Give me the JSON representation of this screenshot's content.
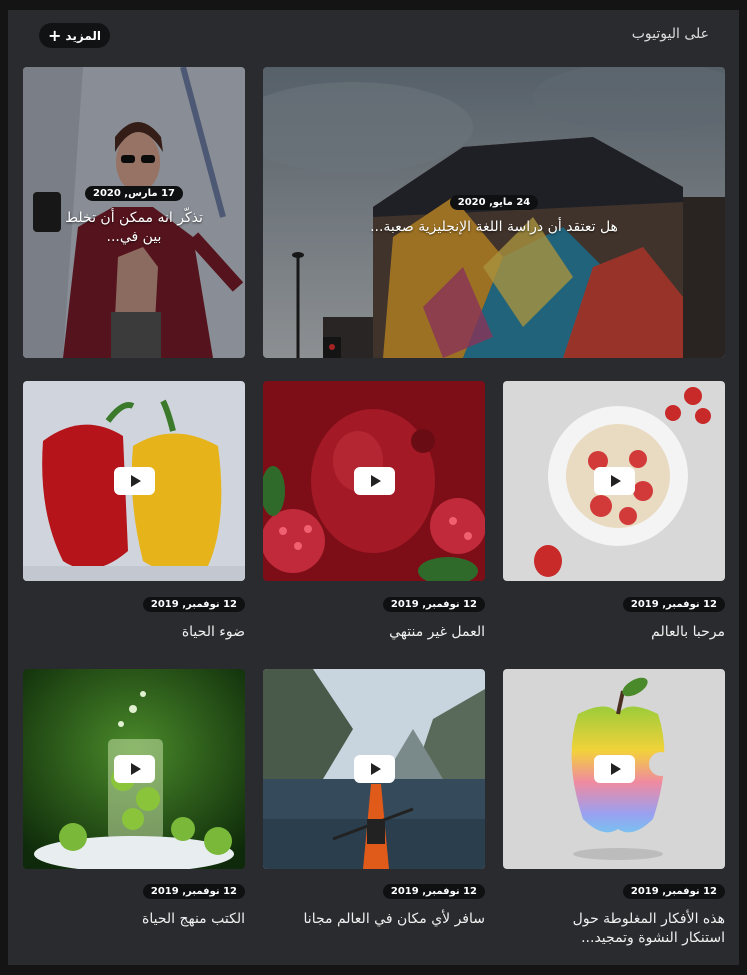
{
  "header": {
    "title": "على اليوتيوب",
    "more_label": "المزيد"
  },
  "hero_posts": [
    {
      "date": "24 مايو, 2020",
      "title": "هل تعتقد أن دراسة اللغة الإنجليزية صعبة..."
    },
    {
      "date": "17 مارس, 2020",
      "title_line1": "تذكّر انه ممكن أن تخلط",
      "title_line2": "بين في..."
    }
  ],
  "videos": [
    {
      "date": "12 نوفمبر, 2019",
      "title": "مرحبا بالعالم"
    },
    {
      "date": "12 نوفمبر, 2019",
      "title": "العمل غير منتهي"
    },
    {
      "date": "12 نوفمبر, 2019",
      "title": "ضوء الحياة"
    },
    {
      "date": "12 نوفمبر, 2019",
      "title_line1": "هذه الأفكار المغلوطة حول",
      "title_line2": "استنكار النشوة وتمجيد..."
    },
    {
      "date": "12 نوفمبر, 2019",
      "title": "سافر لأي مكان في العالم مجانا"
    },
    {
      "date": "12 نوفمبر, 2019",
      "title": "الكتب منهج الحياة"
    }
  ],
  "colors": {
    "background": "#141414",
    "panel": "#2a2b2f",
    "pill": "#0f1012"
  }
}
